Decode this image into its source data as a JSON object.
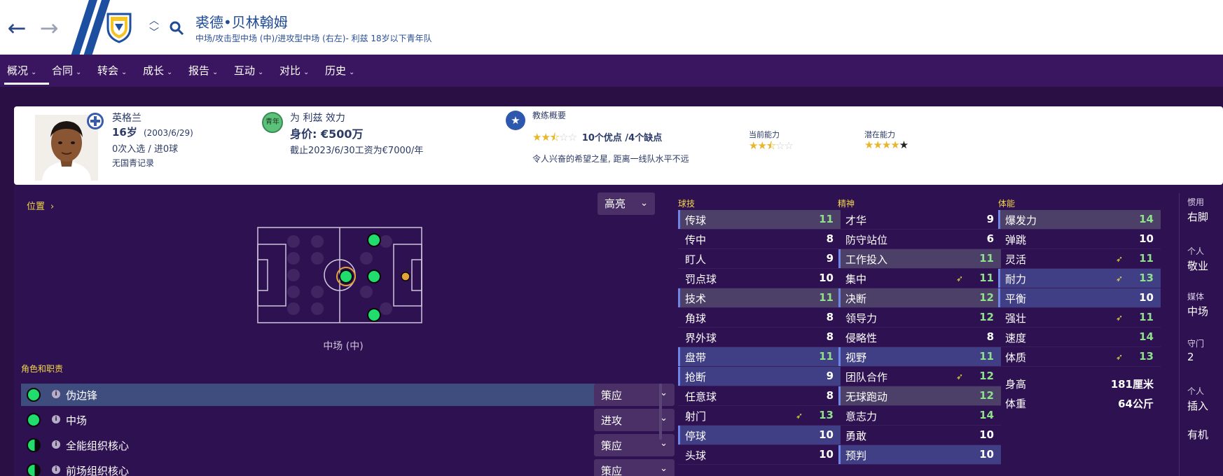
{
  "header": {
    "player_name": "裘德•贝林翰姆",
    "player_subtitle": "中场/攻击型中场 (中)/进攻型中场 (右左)- 利兹 18岁以下青年队"
  },
  "tabs": [
    {
      "label": "概况"
    },
    {
      "label": "合同"
    },
    {
      "label": "转会"
    },
    {
      "label": "成长"
    },
    {
      "label": "报告"
    },
    {
      "label": "互动"
    },
    {
      "label": "对比"
    },
    {
      "label": "历史"
    }
  ],
  "summary": {
    "nation": "英格兰",
    "age": "16岁",
    "dob": "(2003/6/29)",
    "caps": "0次入选 / 进0球",
    "youth_record": "无国青记录",
    "badge": "青年",
    "plays_for": "为 利兹 效力",
    "value": "身价: €500万",
    "contract": "截止2023/6/30工资为€7000/年",
    "coach_title": "教练概要",
    "coach_pros_cons": "10个优点 /4个缺点",
    "coach_stars": 2.5,
    "coach_note": "令人兴奋的希望之星, 距离一线队水平不远",
    "current_ability_label": "当前能力",
    "current_ability_stars": 2.5,
    "potential_ability_label": "潜在能力",
    "potential_ability_stars": 4.5
  },
  "position": {
    "label": "位置",
    "caption": "中场 (中)",
    "highlight_label": "高亮"
  },
  "roles": {
    "label": "角色和职责",
    "items": [
      {
        "name": "伪边锋",
        "duty": "策应"
      },
      {
        "name": "中场",
        "duty": "进攻"
      },
      {
        "name": "全能组织核心",
        "duty": "策应"
      },
      {
        "name": "前场组织核心",
        "duty": "策应"
      }
    ]
  },
  "attributes": {
    "technical_label": "球技",
    "mental_label": "精神",
    "physical_label": "体能",
    "technical": [
      {
        "name": "传球",
        "value": "11",
        "hl": "grey"
      },
      {
        "name": "传中",
        "value": "8"
      },
      {
        "name": "盯人",
        "value": "9"
      },
      {
        "name": "罚点球",
        "value": "10"
      },
      {
        "name": "技术",
        "value": "11",
        "hl": "grey"
      },
      {
        "name": "角球",
        "value": "8"
      },
      {
        "name": "界外球",
        "value": "8"
      },
      {
        "name": "盘带",
        "value": "11",
        "hl": "blue"
      },
      {
        "name": "抢断",
        "value": "9",
        "hl": "blue"
      },
      {
        "name": "任意球",
        "value": "8"
      },
      {
        "name": "射门",
        "value": "13",
        "arrow": true
      },
      {
        "name": "停球",
        "value": "10",
        "hl": "blue"
      },
      {
        "name": "头球",
        "value": "10"
      }
    ],
    "mental": [
      {
        "name": "才华",
        "value": "9"
      },
      {
        "name": "防守站位",
        "value": "6"
      },
      {
        "name": "工作投入",
        "value": "11",
        "hl": "grey"
      },
      {
        "name": "集中",
        "value": "11",
        "arrow": true
      },
      {
        "name": "决断",
        "value": "12",
        "hl": "grey"
      },
      {
        "name": "领导力",
        "value": "12"
      },
      {
        "name": "侵略性",
        "value": "8"
      },
      {
        "name": "视野",
        "value": "11",
        "hl": "blue"
      },
      {
        "name": "团队合作",
        "value": "12",
        "arrow": true
      },
      {
        "name": "无球跑动",
        "value": "12",
        "hl": "grey"
      },
      {
        "name": "意志力",
        "value": "14"
      },
      {
        "name": "勇敢",
        "value": "10"
      },
      {
        "name": "预判",
        "value": "10",
        "hl": "blue"
      }
    ],
    "physical": [
      {
        "name": "爆发力",
        "value": "14",
        "hl": "grey"
      },
      {
        "name": "弹跳",
        "value": "10"
      },
      {
        "name": "灵活",
        "value": "11",
        "arrow": true
      },
      {
        "name": "耐力",
        "value": "13",
        "arrow": true,
        "hl": "blue"
      },
      {
        "name": "平衡",
        "value": "10",
        "hl": "blue"
      },
      {
        "name": "强壮",
        "value": "11",
        "arrow": true
      },
      {
        "name": "速度",
        "value": "14"
      },
      {
        "name": "体质",
        "value": "13",
        "arrow": true
      }
    ],
    "height_label": "身高",
    "height_value": "181厘米",
    "weight_label": "体重",
    "weight_value": "64公斤"
  },
  "side": [
    {
      "label": "惯用",
      "value": "右脚"
    },
    {
      "label": "个人",
      "value": "敬业"
    },
    {
      "label": "媒体",
      "value": "中场"
    },
    {
      "label": "守门",
      "value": "2"
    },
    {
      "label": "个人",
      "value": "插入"
    },
    {
      "label": "",
      "value": "有机"
    }
  ],
  "colors": {
    "background": "#2a0f45",
    "panel": "#2e1150",
    "accent_blue": "#1d4fa0",
    "yellow": "#f2d64b",
    "green_value": "#8fe08a",
    "position_green": "#21dd6e"
  }
}
